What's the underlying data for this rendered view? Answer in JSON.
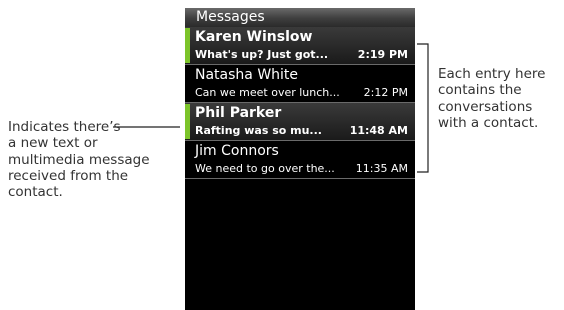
{
  "screen": {
    "title": "Messages",
    "entries": [
      {
        "name": "Karen Winslow",
        "snippet": "What's up? Just got...",
        "time": "2:19 PM",
        "unread": true
      },
      {
        "name": "Natasha White",
        "snippet": "Can we meet over lunch...",
        "time": "2:12 PM",
        "unread": false
      },
      {
        "name": "Phil Parker",
        "snippet": "Rafting was so mu...",
        "time": "11:48 AM",
        "unread": true
      },
      {
        "name": "Jim Connors",
        "snippet": "We need to go over the...",
        "time": "11:35 AM",
        "unread": false
      }
    ]
  },
  "callouts": {
    "left_lines": [
      "Indicates there’s",
      "a new text or",
      "multimedia message",
      "received from the",
      "contact."
    ],
    "right_lines": [
      "Each entry here",
      "contains the",
      "conversations",
      "with a contact."
    ]
  },
  "colors": {
    "unread_indicator": "#7cc42a",
    "screen_background": "#000000"
  }
}
